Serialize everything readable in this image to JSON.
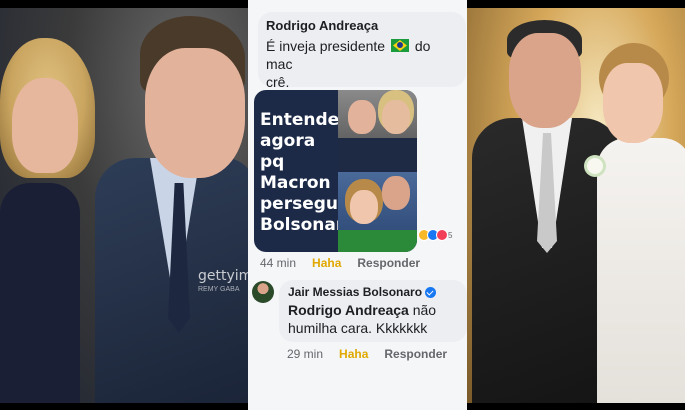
{
  "left_photo": {
    "watermark": "gettyim",
    "watermark_sub": "REMY GABA"
  },
  "comment1": {
    "author": "Rodrigo Andreaça",
    "text_before_flag": "É inveja presidente",
    "flag_icon": "brazil-flag-icon",
    "text_after_flag": "do mac",
    "text_line2": "crê.",
    "meme_text": "Entende agora pq Macron persegue Bolsonaro?",
    "reaction_count": "5",
    "reactions": [
      "haha-icon",
      "like-icon",
      "love-icon"
    ],
    "time": "44 min",
    "haha_label": "Haha",
    "reply_label": "Responder"
  },
  "comment2": {
    "author": "Jair Messias Bolsonaro",
    "mention": "Rodrigo Andreaça",
    "text": "não humilha cara. Kkkkkkk",
    "time": "29 min",
    "haha_label": "Haha",
    "reply_label": "Responder"
  },
  "colors": {
    "haha": "#e0a800",
    "verified": "#1877f2",
    "bubble": "#eceef2"
  }
}
